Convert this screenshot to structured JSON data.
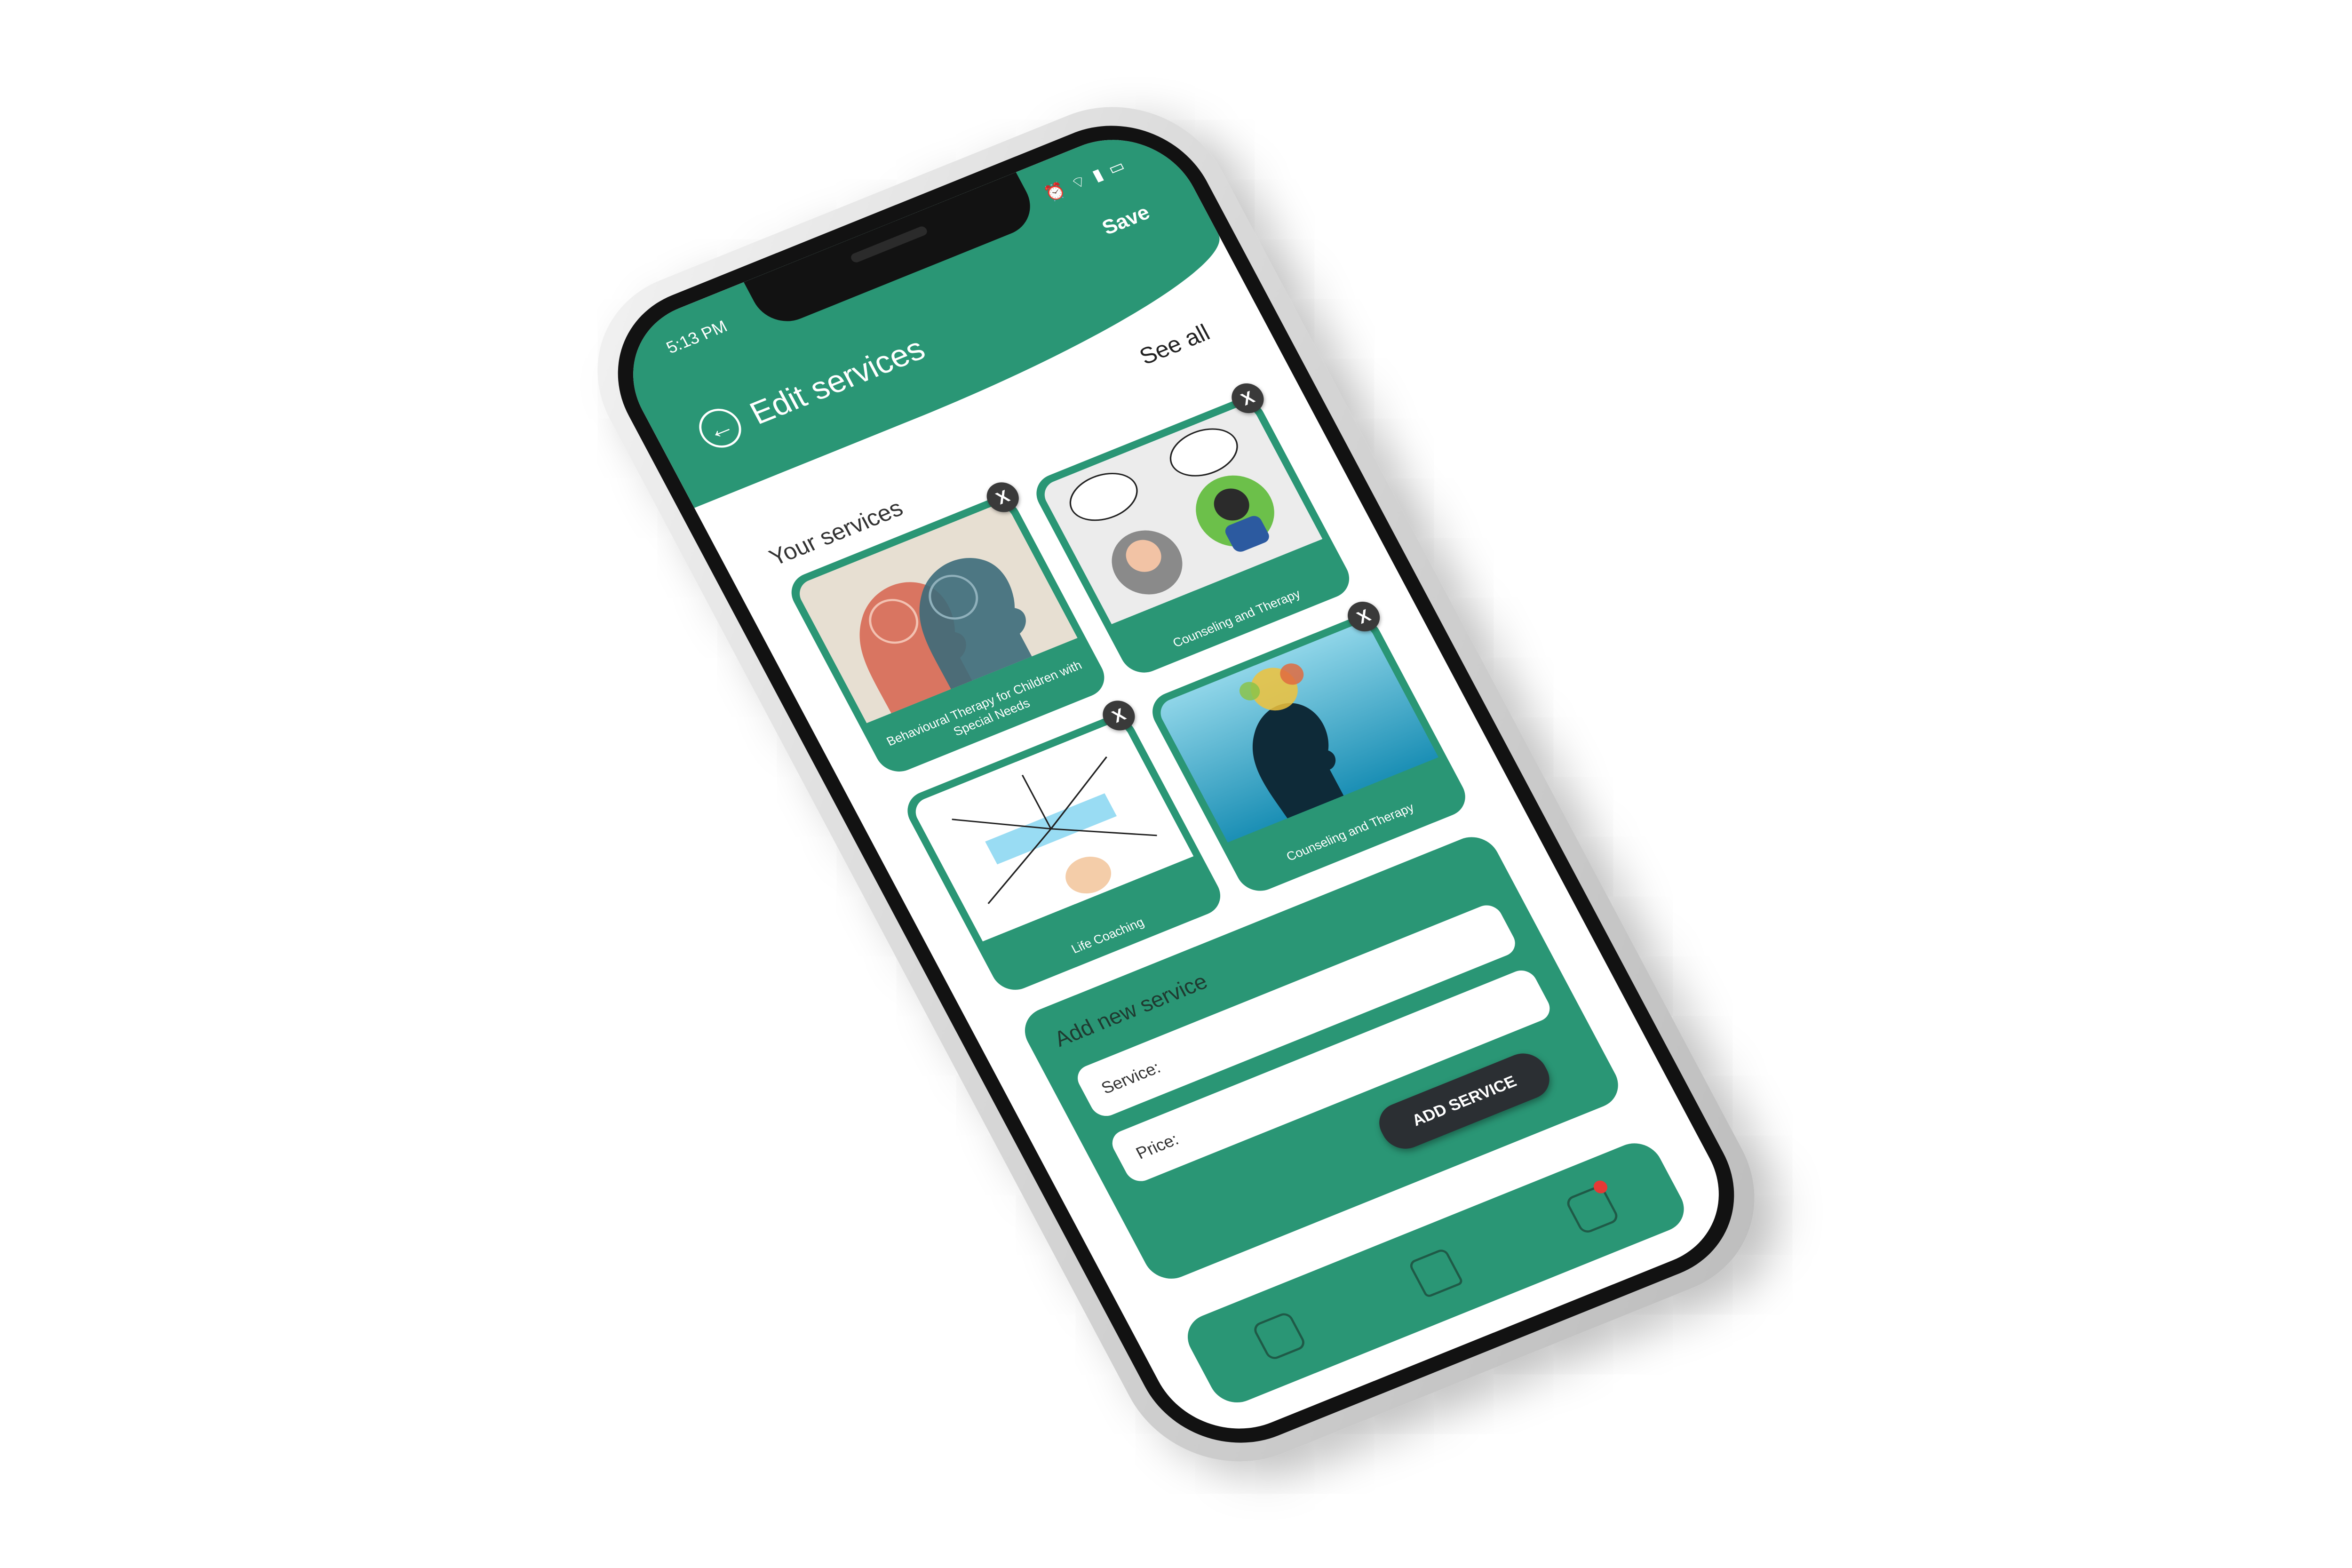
{
  "status_bar": {
    "time": "5:13 PM",
    "icons": [
      "alarm-icon",
      "wifi-icon",
      "signal-icon",
      "battery-icon"
    ]
  },
  "header": {
    "title": "Edit services",
    "save_label": "Save",
    "back_icon": "back-arrow-icon"
  },
  "services_section": {
    "heading": "Your services",
    "see_all_label": "See all",
    "cards": [
      {
        "label": "Behavioural Therapy for Children with Special Needs",
        "close_label": "X"
      },
      {
        "label": "Counseling and Therapy",
        "close_label": "X"
      },
      {
        "label": "Life Coaching",
        "close_label": "X"
      },
      {
        "label": "Counseling and Therapy",
        "close_label": "X"
      }
    ]
  },
  "add_service": {
    "heading": "Add new service",
    "service_label": "Service:",
    "price_label": "Price:",
    "button_label": "ADD SERVICE"
  },
  "bottom_nav": {
    "items": [
      "calendar-icon",
      "home-icon",
      "messages-icon"
    ],
    "notification_color": "#e53935"
  },
  "colors": {
    "accent": "#2a9675",
    "button_dark": "#2b2f33",
    "close_button": "#3a3a3a"
  }
}
